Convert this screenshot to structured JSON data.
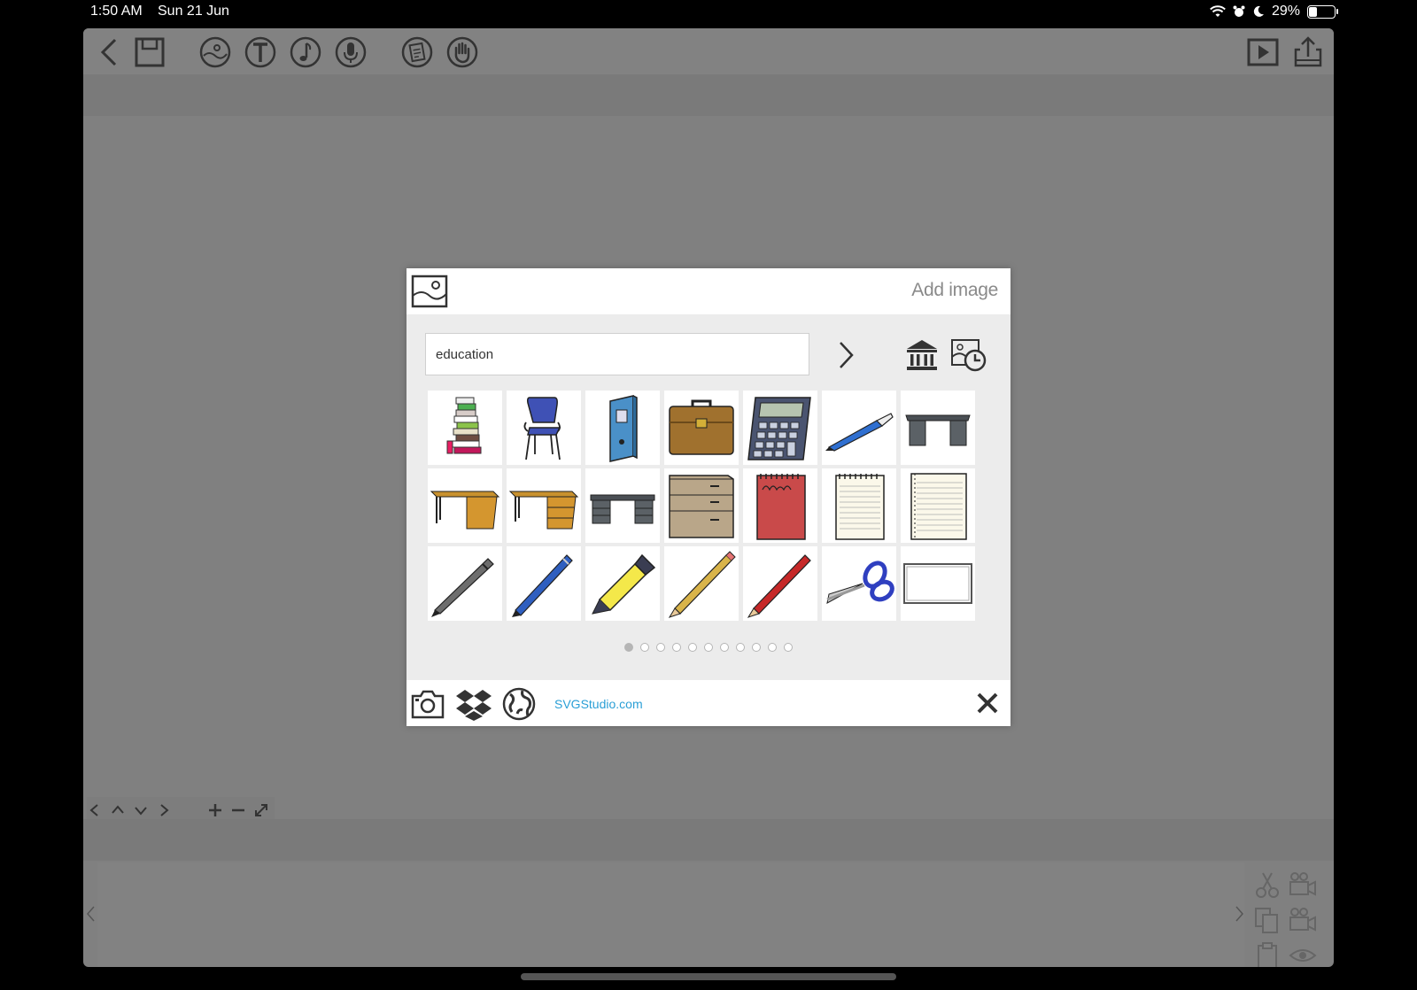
{
  "status_bar": {
    "time": "1:50 AM",
    "date": "Sun 21 Jun",
    "battery": "29%",
    "battery_level": 0.29
  },
  "toolbar": {
    "left": [
      "back-icon",
      "save-icon",
      "background-image-icon",
      "text-icon",
      "music-icon",
      "microphone-icon",
      "notes-icon",
      "hand-icon"
    ],
    "right": [
      "play-icon",
      "share-icon"
    ]
  },
  "dialog": {
    "title": "Add image",
    "search": {
      "value": "education",
      "placeholder": ""
    },
    "images": [
      "books-stack",
      "chair",
      "binder",
      "briefcase",
      "calculator",
      "pen",
      "desk-grey",
      "desk-wood",
      "desk-wood-drawers",
      "desk-grey-drawers",
      "filing-cabinet",
      "notepad",
      "lined-notepad",
      "lined-paper",
      "ballpoint-pen-grey",
      "ballpoint-pen-blue",
      "highlighter",
      "pencil-yellow",
      "pencil-red",
      "scissors",
      "whiteboard"
    ],
    "pages": {
      "count": 11,
      "active": 0
    },
    "footer": {
      "link": "SVGStudio.com"
    }
  },
  "colors": {
    "app_bg": "#808080",
    "link": "#2a9fd6",
    "dialog_bg": "#ececec"
  }
}
